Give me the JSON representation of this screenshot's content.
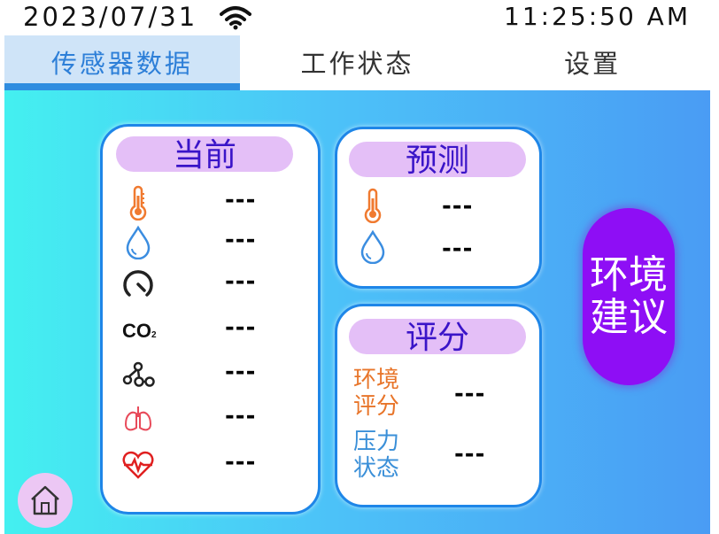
{
  "status": {
    "date": "2023/07/31",
    "time": "11:25:50 AM"
  },
  "tabs": [
    {
      "label": "传感器数据"
    },
    {
      "label": "工作状态"
    },
    {
      "label": "设置"
    }
  ],
  "current": {
    "title": "当前",
    "rows": [
      {
        "icon": "thermometer-icon",
        "value": "---"
      },
      {
        "icon": "humidity-drop-icon",
        "value": "---"
      },
      {
        "icon": "pressure-gauge-icon",
        "value": "---"
      },
      {
        "icon": "co2-icon",
        "icon_text": "CO",
        "icon_sub": "2",
        "value": "---"
      },
      {
        "icon": "molecule-icon",
        "value": "---"
      },
      {
        "icon": "lungs-icon",
        "value": "---"
      },
      {
        "icon": "heart-rate-icon",
        "value": "---"
      }
    ]
  },
  "forecast": {
    "title": "预测",
    "rows": [
      {
        "icon": "thermometer-icon",
        "value": "---"
      },
      {
        "icon": "humidity-drop-icon",
        "value": "---"
      }
    ]
  },
  "score": {
    "title": "评分",
    "env_label": "环境评分",
    "env_value": "---",
    "stress_label": "压力状态",
    "stress_value": "---"
  },
  "advice_button": "环境建议",
  "colors": {
    "accent": "#2f8de0",
    "pill": "#e4bff7",
    "advice": "#8e0ef5",
    "thermo": "#f07a30",
    "drop": "#3b8de0",
    "heart": "#e02020",
    "env_label": "#e8752a",
    "stress_label": "#3a8fd8"
  }
}
